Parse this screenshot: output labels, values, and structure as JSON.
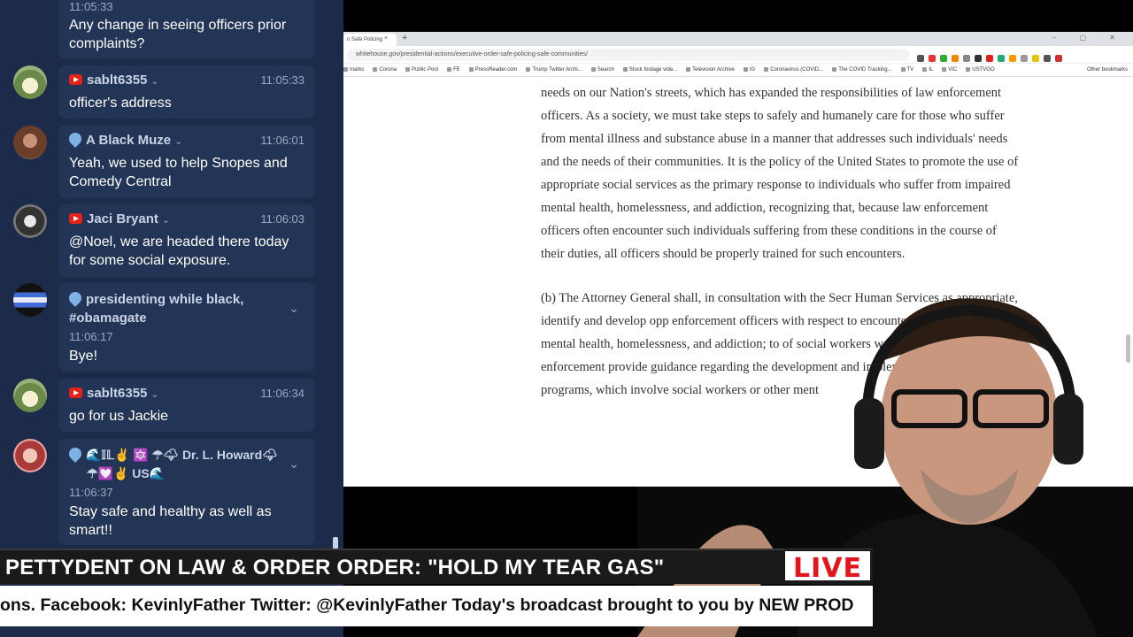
{
  "chat": {
    "messages": [
      {
        "time": "11:05:33",
        "text": "Any change in seeing officers prior complaints?"
      },
      {
        "user": "sablt6355",
        "source": "youtube",
        "time": "11:05:33",
        "text": "officer's address"
      },
      {
        "user": "A Black Muze",
        "source": "pin",
        "time": "11:06:01",
        "text": "Yeah, we used to help Snopes and Comedy Central"
      },
      {
        "user": "Jaci Bryant",
        "source": "youtube",
        "time": "11:06:03",
        "text": "@Noel, we are headed there today for some social exposure."
      },
      {
        "user": "presidenting while black, #obamagate",
        "source": "pin",
        "time": "11:06:17",
        "text": "Bye!"
      },
      {
        "user": "sablt6355",
        "source": "youtube",
        "time": "11:06:34",
        "text": "go for us Jackie"
      },
      {
        "user": "🌊𝕀𝕃✌ 🔯 ☂🌩 Dr. L. Howard🌩",
        "user_line2": "☂💟✌ US🌊",
        "source": "pin",
        "time": "11:06:37",
        "text": "Stay safe and healthy as well as smart!!"
      }
    ],
    "chevron": "⌄"
  },
  "browser": {
    "tab_title": "n Safe Policing",
    "tab_close": "×",
    "new_tab": "+",
    "window_controls": "– ▢ ✕",
    "url": "whitehouse.gov/presidential-actions/executive-order-safe-policing-safe-communities/",
    "bookmarks": [
      "marks",
      "Corona",
      "Public Pool",
      "FE",
      "PressReader.com",
      "Trump Twitter Archi...",
      "Search",
      "Stock footage vide...",
      "Television Archive",
      "IG",
      "Coronavirus (COVID...",
      "The COVID Tracking...",
      "TV",
      "IL",
      "VIC",
      "USTVGO"
    ],
    "other_bookmarks": "Other bookmarks",
    "ext_colors": [
      "#555",
      "#e33",
      "#3a3",
      "#e80",
      "#888",
      "#333",
      "#d22",
      "#2a7",
      "#f90",
      "#999",
      "#e3c200",
      "#555",
      "#c33"
    ]
  },
  "document": {
    "para1": "needs on our Nation's streets, which has expanded the responsibilities of law enforcement officers.  As a society, we must take steps to safely and humanely care for those who suffer from mental illness and substance abuse in a manner that addresses such individuals' needs and the needs of their communities.  It is the policy of the United States to promote the use of appropriate social services as the primary response to individuals who suffer from impaired mental health, homelessness, and addiction, recognizing that, because law enforcement officers often encounter such individuals suffering from these conditions in the course of their duties, all officers should be properly trained for such encounters.",
    "para2": "(b)  The Attorney General shall, in consultation with the Secr Human Services as appropriate, identify and develop opp enforcement officers with respect to encounters with ind impaired mental health, homelessness, and addiction; to of social workers working directly with law enforcement provide guidance regarding the development and implemen responder programs, which involve social workers or other ment"
  },
  "broadcast": {
    "headline": "PETTYDENT ON LAW & ORDER ORDER: \"HOLD MY TEAR GAS\"",
    "live": "LIVE",
    "ticker": "ons.   Facebook: KevinlyFather   Twitter: @KevinlyFather  Today's broadcast brought to you by NEW PROD"
  }
}
